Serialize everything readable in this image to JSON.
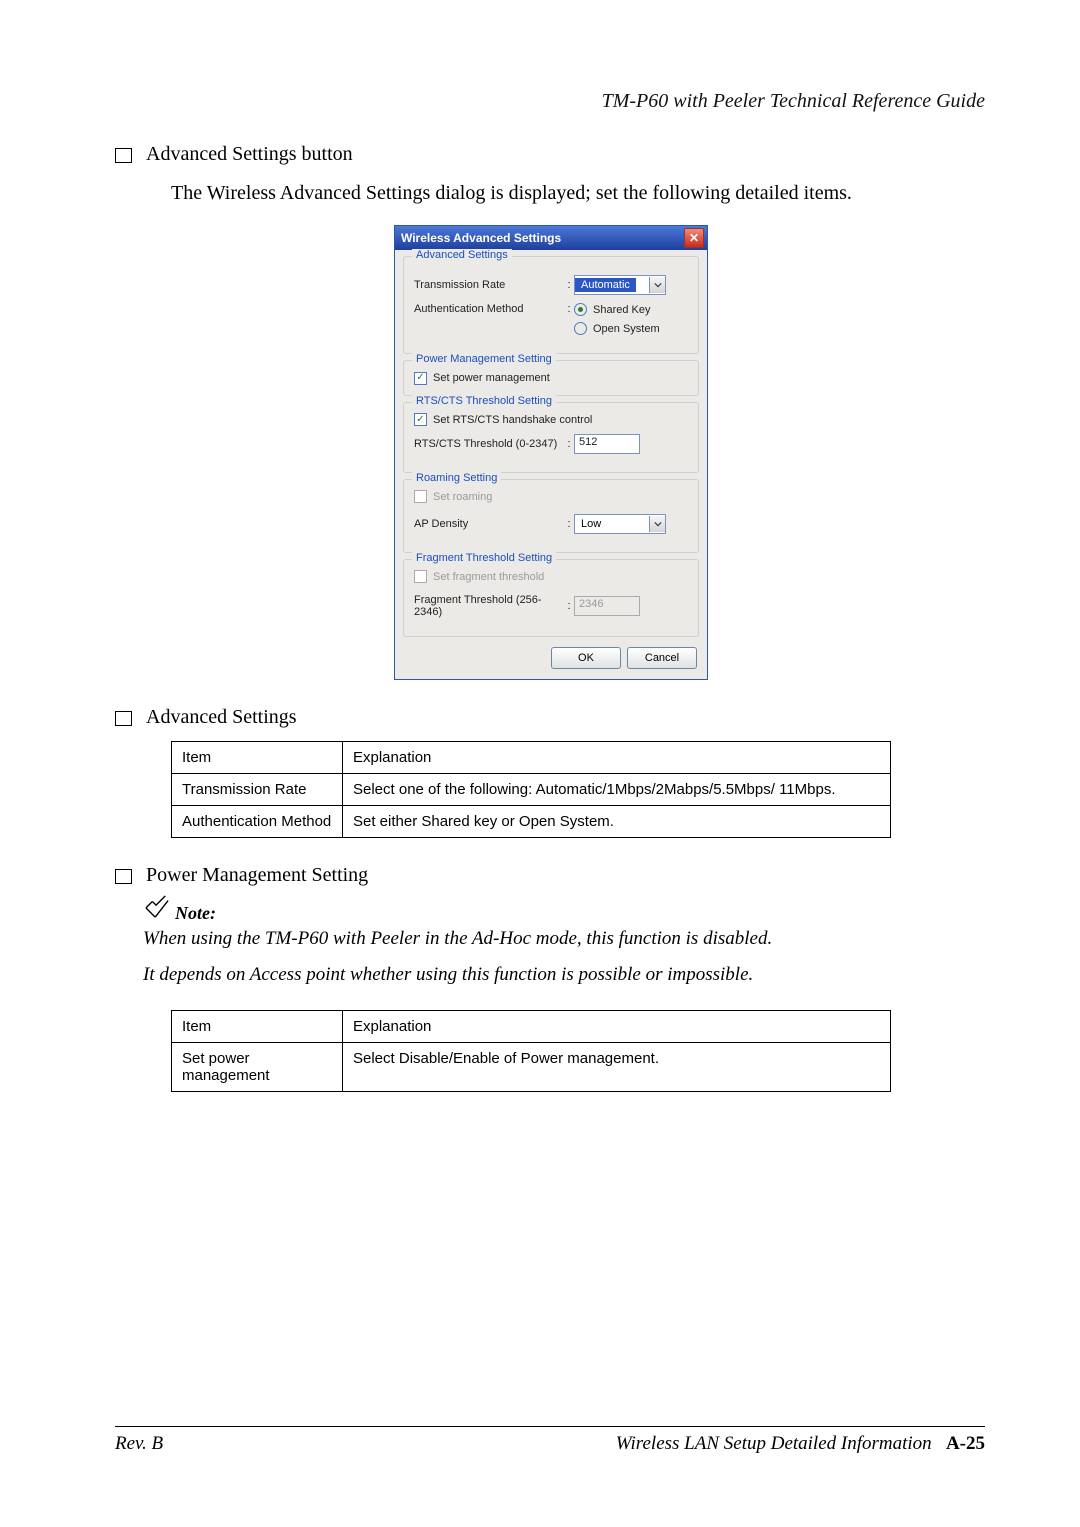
{
  "header": {
    "running_title": "TM-P60 with Peeler Technical Reference Guide"
  },
  "bullets": {
    "b1": "Advanced Settings button",
    "b2": "Advanced Settings",
    "b3": "Power Management Setting"
  },
  "para1": "The Wireless Advanced Settings dialog is displayed; set the following detailed items.",
  "dialog": {
    "title": "Wireless Advanced Settings",
    "groups": {
      "advanced": {
        "legend": "Advanced Settings",
        "tx_rate_label": "Transmission Rate",
        "tx_rate_value": "Automatic",
        "auth_label": "Authentication Method",
        "auth_opts": {
          "shared": "Shared Key",
          "open": "Open System"
        }
      },
      "power": {
        "legend": "Power Management Setting",
        "chk": "Set power management"
      },
      "rts": {
        "legend": "RTS/CTS Threshold Setting",
        "chk": "Set RTS/CTS handshake control",
        "thr_label": "RTS/CTS Threshold (0-2347)",
        "thr_value": "512"
      },
      "roam": {
        "legend": "Roaming Setting",
        "chk": "Set roaming",
        "ap_label": "AP Density",
        "ap_value": "Low"
      },
      "frag": {
        "legend": "Fragment Threshold Setting",
        "chk": "Set fragment threshold",
        "thr_label": "Fragment Threshold (256-2346)",
        "thr_value": "2346"
      }
    },
    "buttons": {
      "ok": "OK",
      "cancel": "Cancel"
    }
  },
  "table1": {
    "h_item": "Item",
    "h_expl": "Explanation",
    "r1_item": "Transmission Rate",
    "r1_expl": "Select one of the following: Automatic/1Mbps/2Mabps/5.5Mbps/ 11Mbps.",
    "r2_item": "Authentication Method",
    "r2_expl": "Set either Shared key or Open System."
  },
  "note": {
    "label": "Note:",
    "l1": "When using the TM-P60 with Peeler in the Ad-Hoc mode, this function is disabled.",
    "l2": "It depends on Access point whether using this function is possible or impossible."
  },
  "table2": {
    "h_item": "Item",
    "h_expl": "Explanation",
    "r1_item": "Set power management",
    "r1_expl": "Select Disable/Enable of Power management."
  },
  "footer": {
    "left": "Rev. B",
    "right_text": "Wireless LAN Setup Detailed Information",
    "right_page": "A-25"
  }
}
